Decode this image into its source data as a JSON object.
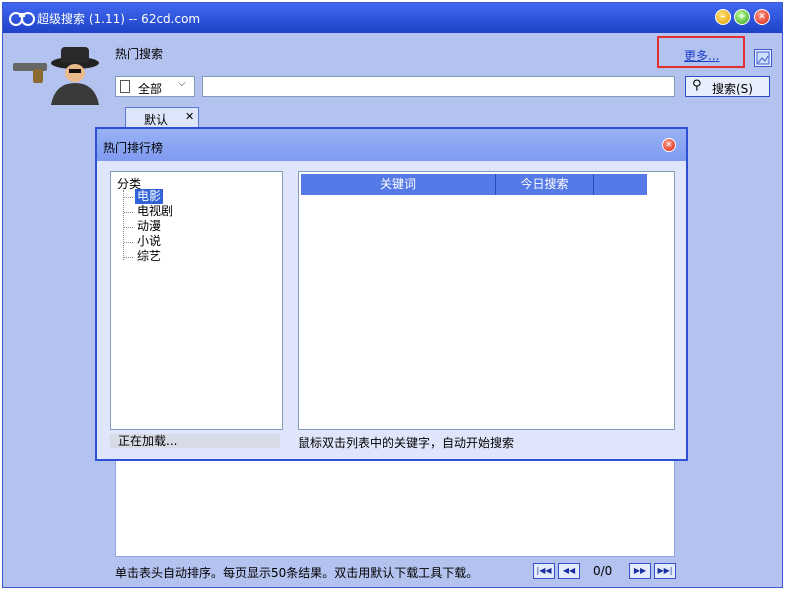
{
  "window": {
    "title": "超级搜索 (1.11) -- 62cd.com"
  },
  "header": {
    "hot_search_label": "热门搜索",
    "more_link": "更多..."
  },
  "search": {
    "category_value": "全部",
    "query_value": "",
    "button_label": "搜索(S)"
  },
  "tabs": [
    {
      "label": "默认"
    }
  ],
  "status_bar": {
    "text": "单击表头自动排序。每页显示50条结果。双击用默认下载工具下载。",
    "page_count": "0/0"
  },
  "dialog": {
    "title": "热门排行榜",
    "tree": {
      "root": "分类",
      "items": [
        "电影",
        "电视剧",
        "动漫",
        "小说",
        "综艺"
      ],
      "selected_index": 0
    },
    "loading_status": "正在加载...",
    "table": {
      "columns": [
        "关键词",
        "今日搜索"
      ],
      "rows": []
    },
    "hint": "鼠标双击列表中的关键字，自动开始搜索"
  },
  "colors": {
    "titlebar": "#2b55e0",
    "window_bg": "#b4c2f0",
    "highlight_box": "#e03030",
    "selection": "#3163d8"
  }
}
